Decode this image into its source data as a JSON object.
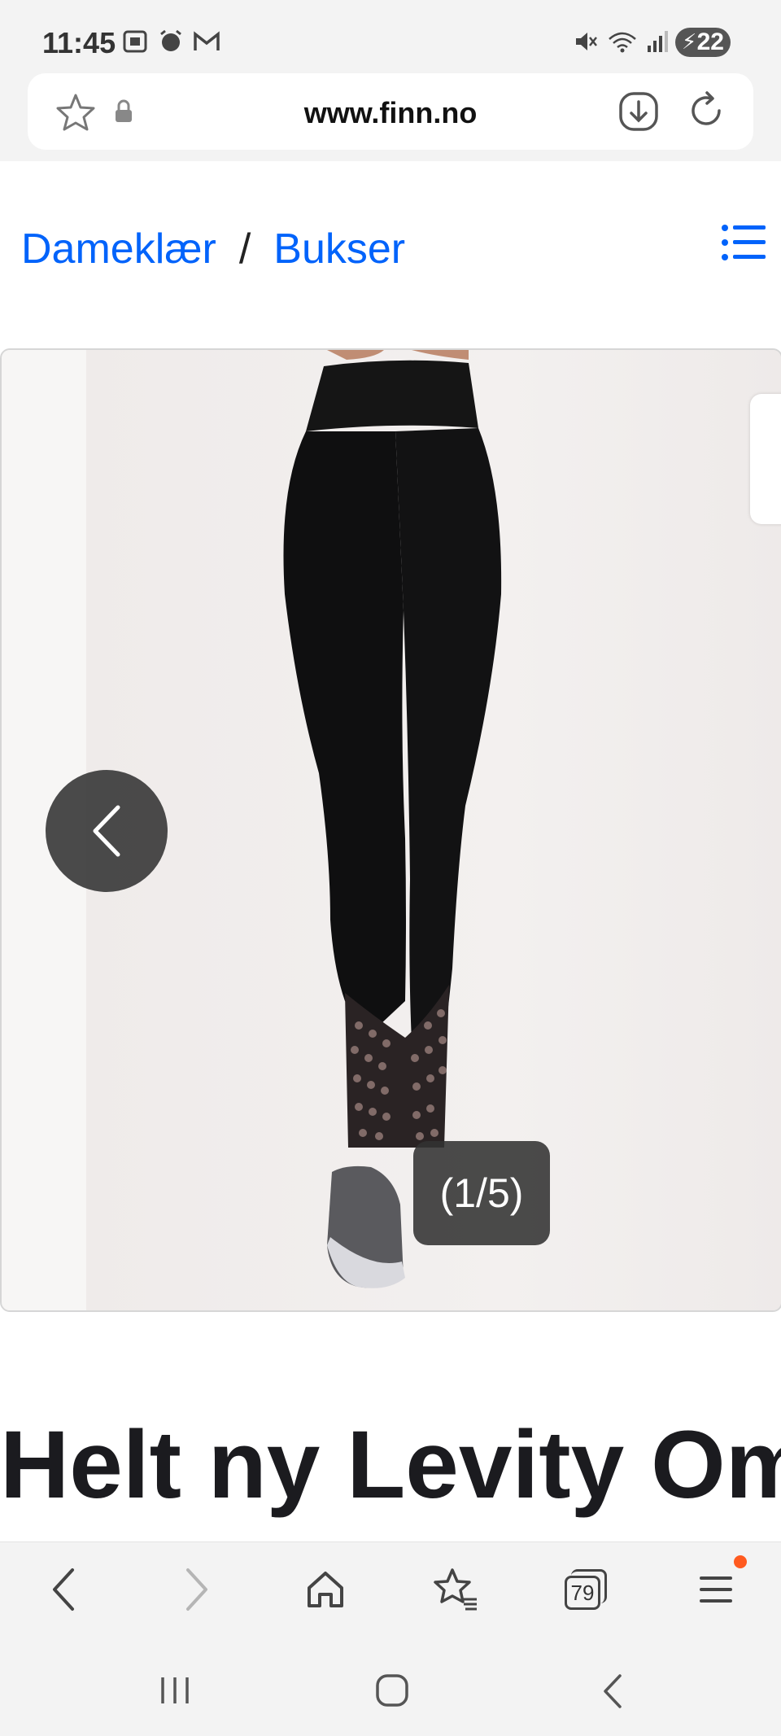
{
  "status_bar": {
    "time": "11:45",
    "battery": "22",
    "icons": [
      "screenshot-icon",
      "alarm-icon",
      "gmail-icon",
      "mute-icon",
      "wifi-icon",
      "signal-icon",
      "battery-icon"
    ]
  },
  "browser": {
    "url": "www.finn.no",
    "tab_count": "79"
  },
  "breadcrumb": {
    "items": [
      "Dameklær",
      "Bukser"
    ],
    "separator": "/"
  },
  "gallery": {
    "counter": "(1/5)"
  },
  "listing": {
    "title": "Helt ny Levity Omb"
  },
  "colors": {
    "link": "#0063fb",
    "title": "#1b1b1f",
    "overlay": "#323232",
    "notification_dot": "#ff5a1f"
  }
}
